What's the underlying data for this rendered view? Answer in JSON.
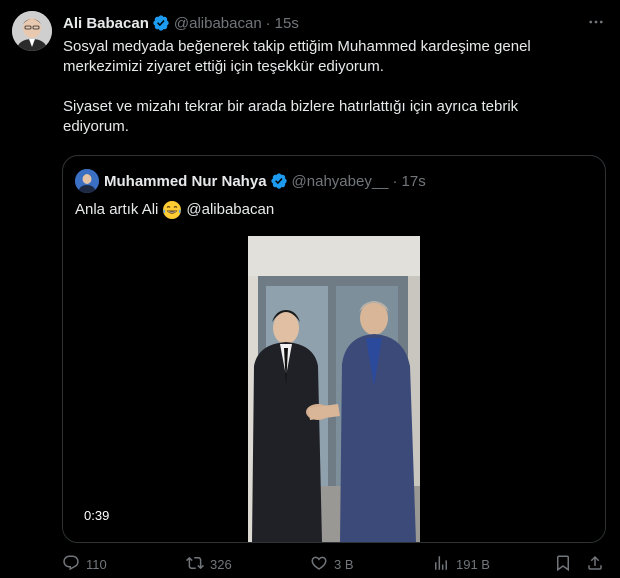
{
  "tweet": {
    "author_name": "Ali Babacan",
    "author_handle": "@alibabacan",
    "separator": "·",
    "time": "15s",
    "paragraphs": [
      "Sosyal medyada beğenerek takip ettiğim Muhammed kardeşime genel merkezimizi ziyaret ettiği için teşekkür ediyorum.",
      "Siyaset ve mizahı tekrar bir arada bizlere hatırlattığı için ayrıca tebrik ediyorum."
    ]
  },
  "quote": {
    "author_name": "Muhammed Nur Nahya",
    "author_handle": "@nahyabey__",
    "separator": "·",
    "time": "17s",
    "text_before": "Anla artık Ali",
    "emoji": "laughing-tears-emoji",
    "text_after": "@alibabacan",
    "video_duration": "0:39"
  },
  "actions": {
    "replies": "110",
    "reposts": "326",
    "likes": "3 B",
    "views": "191 B"
  },
  "colors": {
    "background": "#000000",
    "text": "#e7e9ea",
    "muted": "#71767b",
    "border": "#2f3336",
    "verified": "#1d9bf0"
  },
  "icons": [
    "more-icon",
    "verified-icon",
    "reply-icon",
    "repost-icon",
    "like-icon",
    "views-icon",
    "bookmark-icon",
    "share-icon"
  ]
}
